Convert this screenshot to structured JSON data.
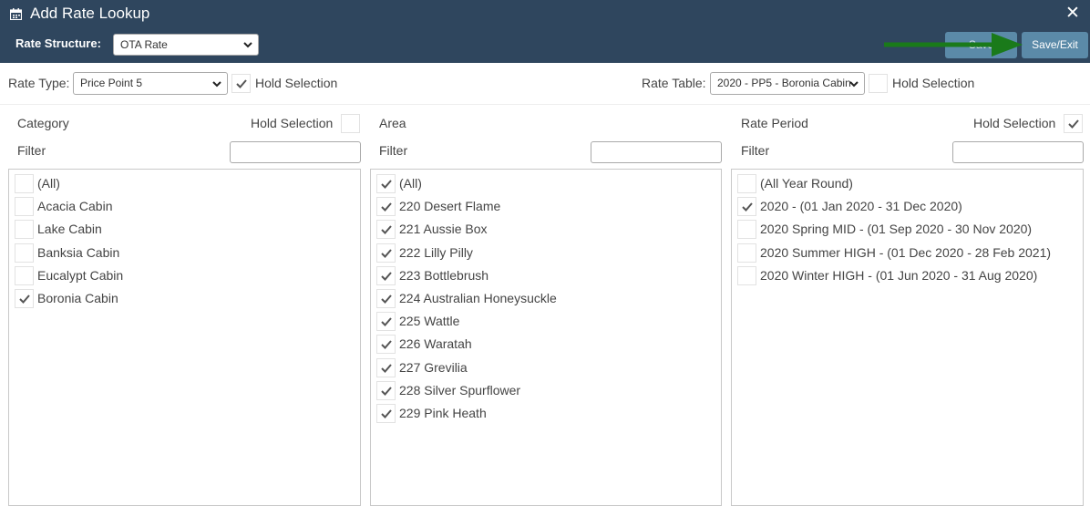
{
  "header": {
    "title": "Add Rate Lookup",
    "close": "✕",
    "rate_structure_label": "Rate Structure:",
    "rate_structure_value": "OTA Rate",
    "hidden_button_label": "Save",
    "save_exit_label": "Save/Exit"
  },
  "toolbar": {
    "rate_type_label": "Rate Type:",
    "rate_type_value": "Price Point 5",
    "rate_type_hold_label": "Hold Selection",
    "rate_table_label": "Rate Table:",
    "rate_table_value": "2020 - PP5 - Boronia Cabin",
    "rate_table_hold_label": "Hold Selection"
  },
  "category": {
    "title": "Category",
    "hold_label": "Hold Selection",
    "filter_label": "Filter",
    "items": [
      {
        "label": "(All)",
        "checked": false
      },
      {
        "label": "Acacia Cabin",
        "checked": false
      },
      {
        "label": "Lake Cabin",
        "checked": false
      },
      {
        "label": "Banksia Cabin",
        "checked": false
      },
      {
        "label": "Eucalypt Cabin",
        "checked": false
      },
      {
        "label": "Boronia Cabin",
        "checked": true
      }
    ]
  },
  "area": {
    "title": "Area",
    "filter_label": "Filter",
    "items": [
      {
        "label": "(All)",
        "checked": true
      },
      {
        "label": "220 Desert Flame",
        "checked": true
      },
      {
        "label": "221 Aussie Box",
        "checked": true
      },
      {
        "label": "222 Lilly Pilly",
        "checked": true
      },
      {
        "label": "223 Bottlebrush",
        "checked": true
      },
      {
        "label": "224 Australian Honeysuckle",
        "checked": true
      },
      {
        "label": "225 Wattle",
        "checked": true
      },
      {
        "label": "226 Waratah",
        "checked": true
      },
      {
        "label": "227 Grevilia",
        "checked": true
      },
      {
        "label": "228 Silver Spurflower",
        "checked": true
      },
      {
        "label": "229 Pink Heath",
        "checked": true
      }
    ]
  },
  "rate_period": {
    "title": "Rate Period",
    "hold_label": "Hold Selection",
    "filter_label": "Filter",
    "items": [
      {
        "label": "(All Year Round)",
        "checked": false
      },
      {
        "label": "2020 - (01 Jan 2020 - 31 Dec 2020)",
        "checked": true
      },
      {
        "label": "2020 Spring MID - (01 Sep 2020 - 30 Nov 2020)",
        "checked": false
      },
      {
        "label": "2020 Summer HIGH - (01 Dec 2020 - 28 Feb 2021)",
        "checked": false
      },
      {
        "label": "2020 Winter HIGH - (01 Jun 2020 - 31 Aug 2020)",
        "checked": false
      }
    ]
  },
  "colors": {
    "header_bg": "#2f465e",
    "button_bg": "#5b8aa8",
    "arrow": "#1a7a1a"
  }
}
